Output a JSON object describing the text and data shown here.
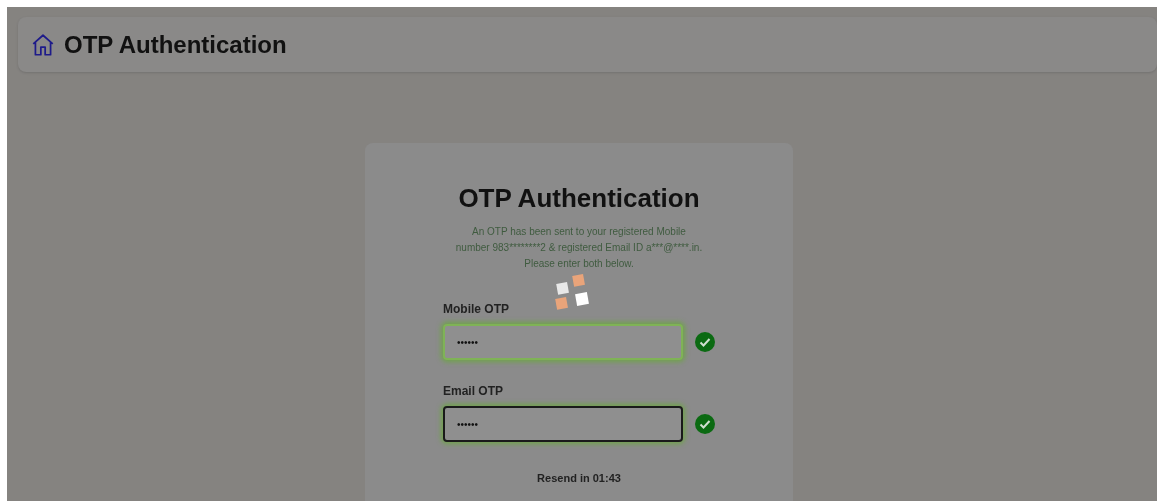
{
  "header": {
    "title": "OTP Authentication"
  },
  "card": {
    "title": "OTP Authentication",
    "message": "An OTP has been sent to your registered Mobile number 983********2 & registered Email ID a***@****.in. Please enter both below.",
    "fields": [
      {
        "label": "Mobile OTP",
        "value": "••••••",
        "focused": false,
        "verified": true
      },
      {
        "label": "Email OTP",
        "value": "••••••",
        "focused": true,
        "verified": true
      }
    ],
    "resend": "Resend in 01:43"
  }
}
